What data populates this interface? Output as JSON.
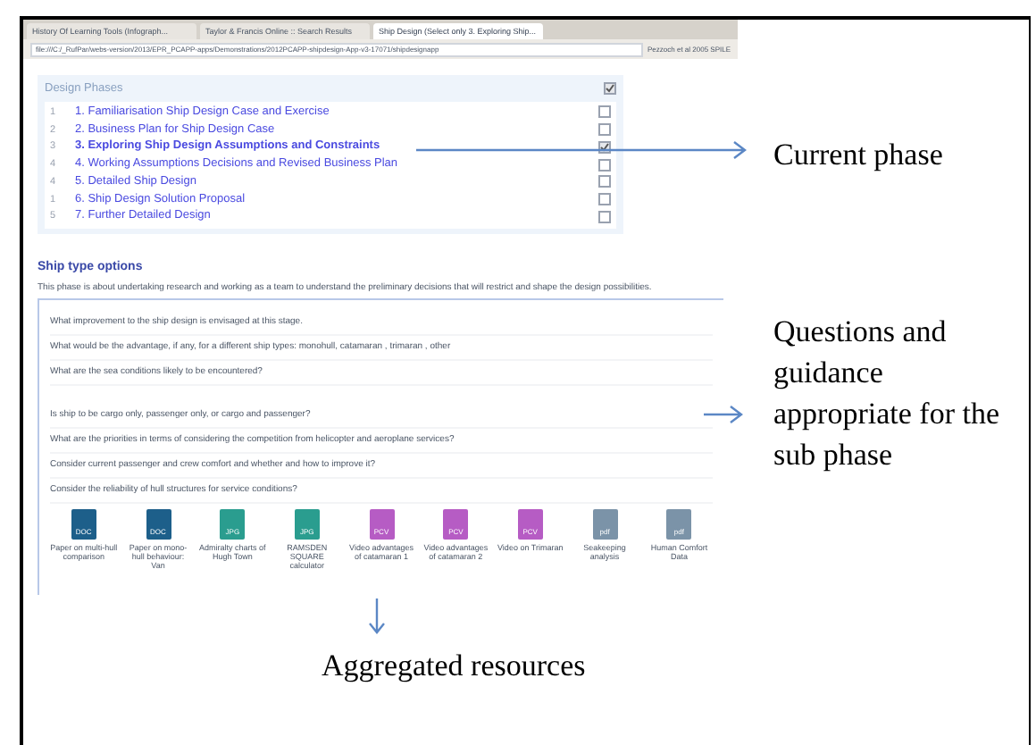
{
  "browser": {
    "tabs": [
      {
        "label": "History Of Learning Tools (Infograph...",
        "selected": false
      },
      {
        "label": "Taylor & Francis Online :: Search Results",
        "selected": false
      },
      {
        "label": "Ship Design (Select only 3. Exploring Ship...",
        "selected": true
      }
    ],
    "address": "file:///C:/_RufPar/webs-version/2013/EPR_PCAPP-apps/Demonstrations/2012PCAPP-shipdesign-App-v3-17071/shipdesignapp",
    "bookmark": "Pezzoch et al 2005 SPILE"
  },
  "design_phases": {
    "title": "Design Phases",
    "checked": true,
    "items": [
      {
        "count": "1",
        "label": "1. Familiarisation Ship Design Case and Exercise",
        "selected": false,
        "checked": false
      },
      {
        "count": "2",
        "label": "2. Business Plan for Ship Design Case",
        "selected": false,
        "checked": false
      },
      {
        "count": "3",
        "label": "3. Exploring Ship Design Assumptions and Constraints",
        "selected": true,
        "checked": true
      },
      {
        "count": "4",
        "label": "4. Working Assumptions Decisions and Revised Business Plan",
        "selected": false,
        "checked": false
      },
      {
        "count": "4",
        "label": "5. Detailed Ship Design",
        "selected": false,
        "checked": false
      },
      {
        "count": "1",
        "label": "6. Ship Design Solution Proposal",
        "selected": false,
        "checked": false
      },
      {
        "count": "5",
        "label": "7. Further Detailed Design",
        "selected": false,
        "checked": false
      }
    ]
  },
  "section": {
    "title": "Ship type options",
    "description": "This phase is about undertaking research and working as a team to understand the preliminary decisions that will restrict and shape the design possibilities.",
    "questions": [
      "What improvement to the ship design is envisaged at this stage.",
      "What would be the advantage, if any, for a different ship types: monohull, catamaran , trimaran , other",
      "What are the sea conditions likely to be encountered?",
      "Is ship to be cargo only, passenger only, or cargo and passenger?",
      "What are the priorities in terms of considering the competition from helicopter and aeroplane services?",
      "Consider current passenger and crew comfort and whether and how to improve it?",
      "Consider the reliability of hull structures for service conditions?"
    ],
    "resources": [
      {
        "kind": "doc",
        "type": "DOC",
        "label": "Paper on multi-hull comparison"
      },
      {
        "kind": "doc",
        "type": "DOC",
        "label": "Paper on mono-hull behaviour: Van"
      },
      {
        "kind": "jpg",
        "type": "JPG",
        "label": "Admiralty charts of Hugh Town"
      },
      {
        "kind": "jpg",
        "type": "JPG",
        "label": "RAMSDEN SQUARE calculator"
      },
      {
        "kind": "video",
        "type": "PCV",
        "label": "Video advantages of catamaran 1"
      },
      {
        "kind": "video",
        "type": "PCV",
        "label": "Video advantages of catamaran 2"
      },
      {
        "kind": "video",
        "type": "PCV",
        "label": "Video on Trimaran"
      },
      {
        "kind": "pdf",
        "type": "pdf",
        "label": "Seakeeping analysis"
      },
      {
        "kind": "pdf",
        "type": "pdf",
        "label": "Human Comfort Data"
      }
    ]
  },
  "annotations": {
    "current_phase": "Current phase",
    "questions": "Questions and guidance appropriate for the sub phase",
    "resources": "Aggregated resources"
  }
}
